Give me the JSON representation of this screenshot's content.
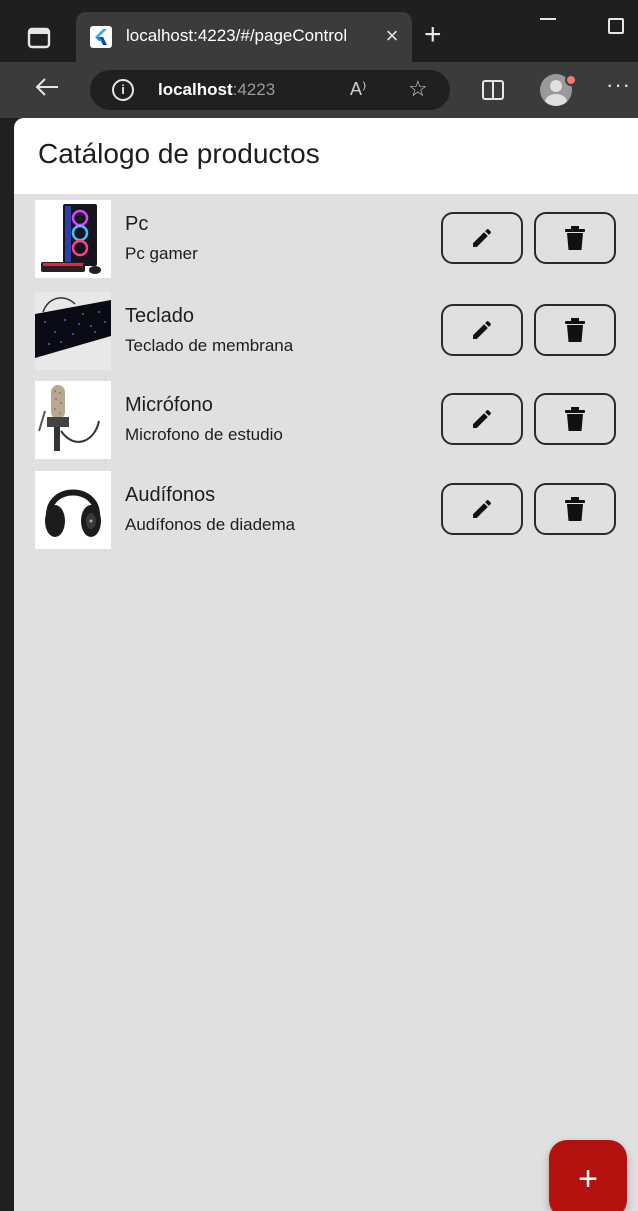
{
  "browser": {
    "tab_title": "localhost:4223/#/pageControl",
    "tab_close": "×",
    "new_tab": "+",
    "url_host": "localhost",
    "url_port": ":4223",
    "read_aloud": "A⁾",
    "favorite": "☆",
    "more": "···"
  },
  "app": {
    "title": "Catálogo de productos",
    "products": [
      {
        "name": "Pc",
        "description": "Pc gamer",
        "image": "gaming-pc-image"
      },
      {
        "name": "Teclado",
        "description": "Teclado de membrana",
        "image": "keyboard-image"
      },
      {
        "name": "Micrófono",
        "description": "Microfono de estudio",
        "image": "microphone-image"
      },
      {
        "name": "Audífonos",
        "description": "Audífonos de diadema",
        "image": "headphones-image"
      }
    ],
    "fab_label": "+"
  },
  "colors": {
    "background": "#e0e0e0",
    "appbar": "#ffffff",
    "fab": "#b3120f"
  }
}
